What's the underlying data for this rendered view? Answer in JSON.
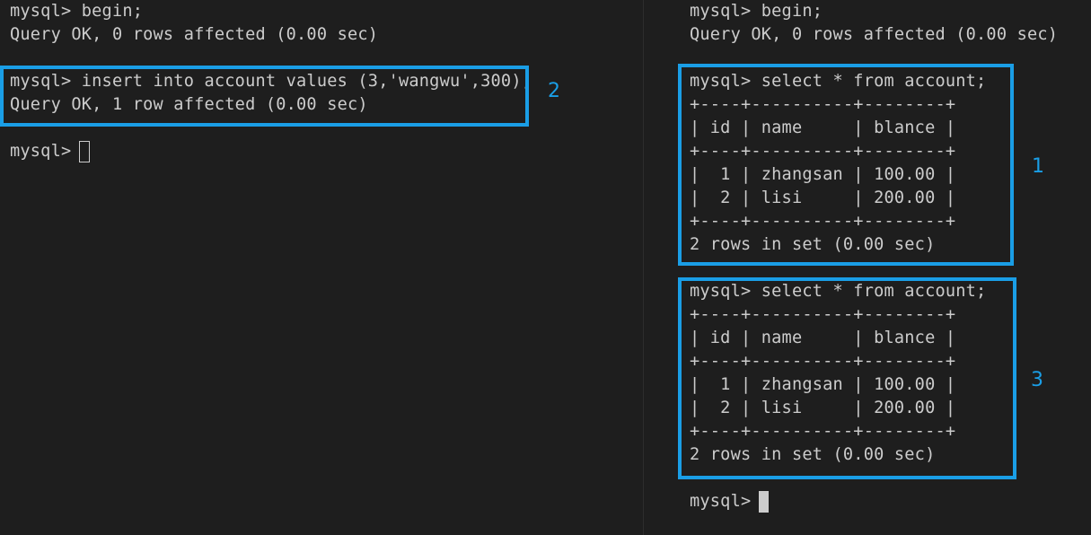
{
  "left_terminal": {
    "lines": [
      "mysql> begin;",
      "Query OK, 0 rows affected (0.00 sec)",
      "mysql> insert into account values (3,'wangwu',300);",
      "Query OK, 1 row affected (0.00 sec)",
      "mysql> "
    ],
    "annotation": "2"
  },
  "right_terminal": {
    "lines": [
      "mysql> begin;",
      "Query OK, 0 rows affected (0.00 sec)",
      "mysql> select * from account;",
      "+----+----------+--------+",
      "| id | name     | blance |",
      "+----+----------+--------+",
      "|  1 | zhangsan | 100.00 |",
      "|  2 | lisi     | 200.00 |",
      "+----+----------+--------+",
      "2 rows in set (0.00 sec)",
      "mysql> select * from account;",
      "+----+----------+--------+",
      "| id | name     | blance |",
      "+----+----------+--------+",
      "|  1 | zhangsan | 100.00 |",
      "|  2 | lisi     | 200.00 |",
      "+----+----------+--------+",
      "2 rows in set (0.00 sec)",
      "mysql> "
    ],
    "annotation_1": "1",
    "annotation_3": "3"
  },
  "colors": {
    "background": "#1e1e1e",
    "text": "#cccccc",
    "highlight": "#1a9ee6"
  }
}
